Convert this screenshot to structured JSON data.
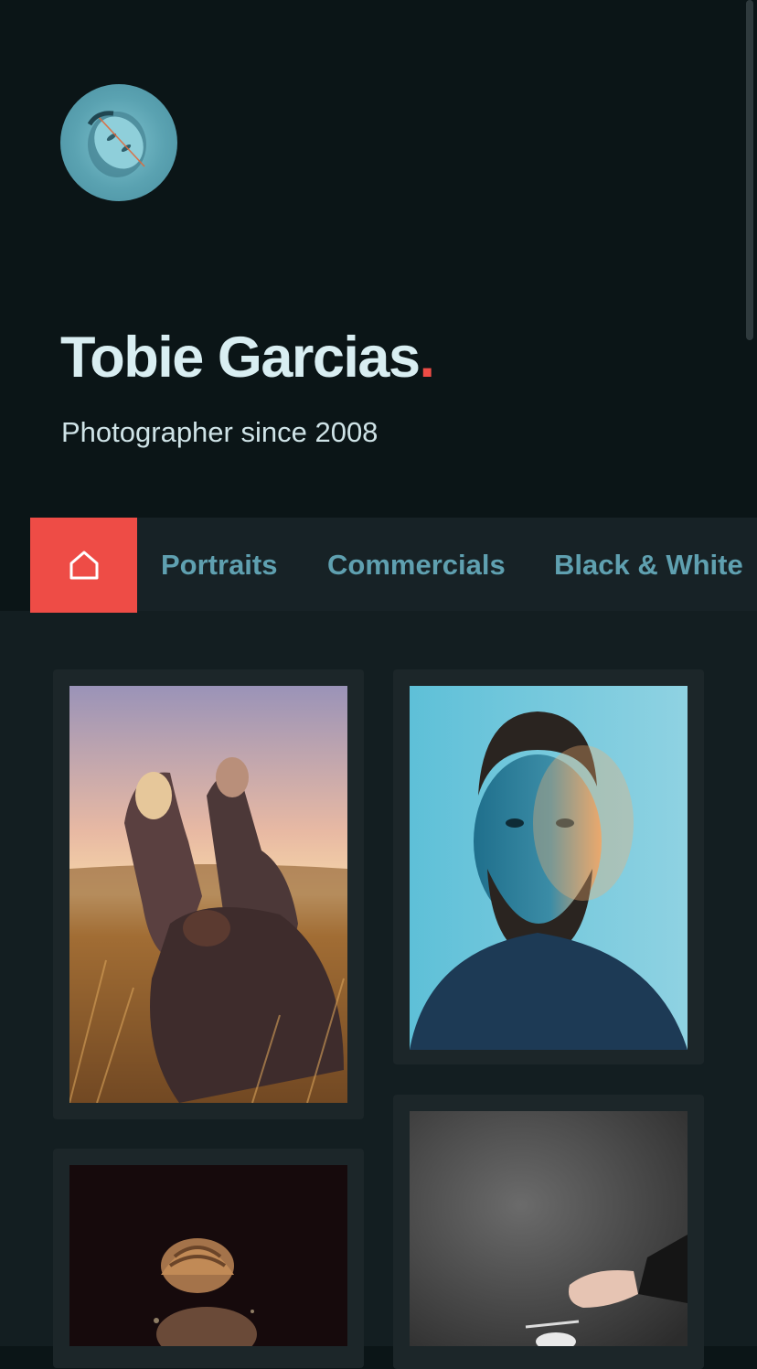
{
  "profile": {
    "name": "Tobie Garcias",
    "name_dot": ".",
    "tagline": "Photographer since 2008"
  },
  "nav": {
    "home_icon": "home-icon",
    "tabs": [
      {
        "label": "Portraits"
      },
      {
        "label": "Commercials"
      },
      {
        "label": "Black & White"
      }
    ]
  },
  "colors": {
    "background": "#0b1517",
    "accent": "#ee4c46",
    "tab_text": "#5fa0b0",
    "name_text": "#d9eef2"
  },
  "gallery": {
    "photos": [
      {
        "subject": "two women dancing in golden grass field at sunset"
      },
      {
        "subject": "bearded man double exposure portrait with blue and orange light"
      },
      {
        "subject": "person with braided hair in dark studio"
      },
      {
        "subject": "hand holding a cup against smoky grey backdrop"
      }
    ]
  }
}
